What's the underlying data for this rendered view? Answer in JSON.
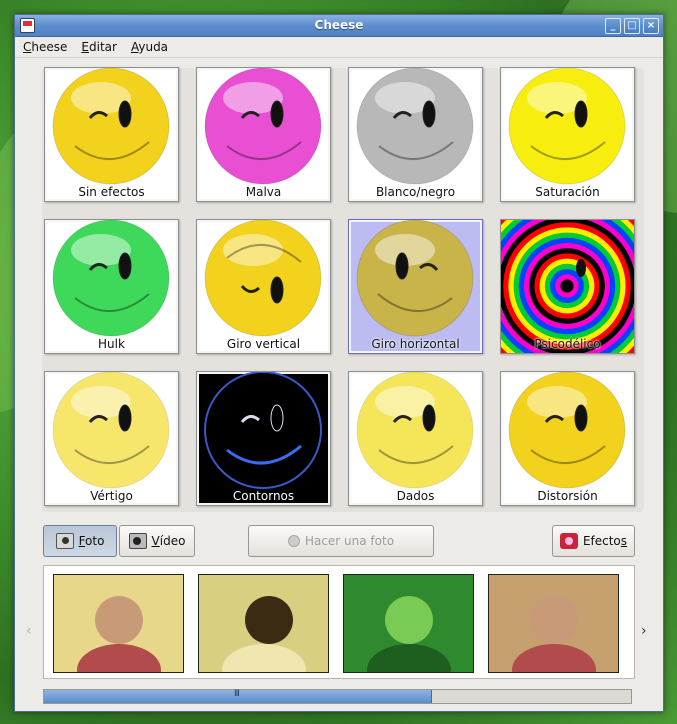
{
  "window": {
    "title": "Cheese"
  },
  "menu": [
    {
      "label": "Cheese",
      "mnemonic": "C",
      "rest": "heese"
    },
    {
      "label": "Editar",
      "mnemonic": "E",
      "rest": "ditar"
    },
    {
      "label": "Ayuda",
      "mnemonic": "A",
      "rest": "yuda"
    }
  ],
  "effects": [
    {
      "label": "Sin efectos",
      "color": "#f2d21c"
    },
    {
      "label": "Malva",
      "color": "#e84fd2"
    },
    {
      "label": "Blanco/negro",
      "color": "#b8b8b8"
    },
    {
      "label": "Saturación",
      "color": "#f7ee10"
    },
    {
      "label": "Hulk",
      "color": "#3ed95a"
    },
    {
      "label": "Giro vertical",
      "color": "#f2d21c"
    },
    {
      "label": "Giro horizontal",
      "color": "#c9b44a",
      "selected": true
    },
    {
      "label": "Psicodélico",
      "color": "#ff0000"
    },
    {
      "label": "Vértigo",
      "color": "#f4de3c"
    },
    {
      "label": "Contornos",
      "color": "#000000"
    },
    {
      "label": "Dados",
      "color": "#f2de22"
    },
    {
      "label": "Distorsión",
      "color": "#f2d21c"
    }
  ],
  "buttons": {
    "photo": {
      "mnemonic": "F",
      "rest": "oto"
    },
    "video": {
      "mnemonic": "V",
      "rest": "ídeo"
    },
    "take_photo": "Hacer una foto",
    "effects": {
      "pre": "Efecto",
      "mnemonic": "s"
    }
  },
  "thumbnails": [
    {
      "name": "thumb-family",
      "bg": "#e7d78a"
    },
    {
      "name": "thumb-swirl",
      "bg": "#d8d080"
    },
    {
      "name": "thumb-hulk-girl",
      "bg": "#2f8a2f"
    },
    {
      "name": "thumb-baby",
      "bg": "#c7a070"
    }
  ],
  "scroll": {
    "arrow_left": "‹",
    "arrow_right": "›",
    "grip": "III",
    "position": 0.66
  }
}
